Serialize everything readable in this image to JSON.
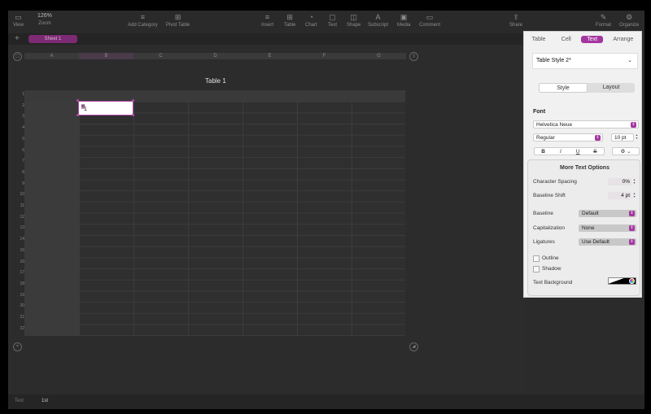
{
  "toolbar": {
    "view": "View",
    "zoom_value": "126%",
    "zoom": "Zoom",
    "add_category": "Add Category",
    "pivot_table": "Pivot Table",
    "insert": "Insert",
    "table": "Table",
    "chart": "Chart",
    "text": "Text",
    "shape": "Shape",
    "subscript": "Subscript",
    "media": "Media",
    "comment": "Comment",
    "share": "Share",
    "format": "Format",
    "organize": "Organize"
  },
  "sheets": {
    "add": "+",
    "active": "Sheet 1"
  },
  "table": {
    "title": "Table 1",
    "columns": [
      "A",
      "B",
      "C",
      "D",
      "E",
      "F",
      "G"
    ],
    "rows": [
      "1",
      "2",
      "3",
      "4",
      "5",
      "6",
      "7",
      "8",
      "9",
      "10",
      "11",
      "12",
      "13",
      "14",
      "15",
      "16",
      "17",
      "18",
      "19",
      "20",
      "21",
      "22"
    ],
    "cell_text_main": "1",
    "cell_text_super": "st"
  },
  "footer": {
    "mode": "Text",
    "value": "1st"
  },
  "panel": {
    "tabs": [
      "Table",
      "Cell",
      "Text",
      "Arrange"
    ],
    "active_tab": "Text",
    "table_style": "Table Style 2*",
    "segments": [
      "Style",
      "Layout"
    ],
    "font_label": "Font",
    "font_family": "Helvetica Neue",
    "font_weight": "Regular",
    "font_size": "10 pt",
    "format_buttons": [
      "B",
      "I",
      "U",
      "S"
    ],
    "more": {
      "title": "More Text Options",
      "char_spacing_label": "Character Spacing",
      "char_spacing_value": "0%",
      "baseline_shift_label": "Baseline Shift",
      "baseline_shift_value": "4 pt",
      "baseline_label": "Baseline",
      "baseline_value": "Default",
      "capitalization_label": "Capitalization",
      "capitalization_value": "None",
      "ligatures_label": "Ligatures",
      "ligatures_value": "Use Default",
      "outline_label": "Outline",
      "shadow_label": "Shadow",
      "text_background_label": "Text Background"
    }
  },
  "colors": {
    "accent": "#a436a0"
  }
}
